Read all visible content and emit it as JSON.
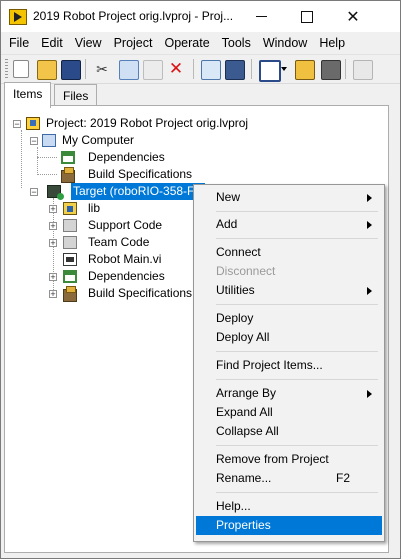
{
  "window": {
    "title": "2019 Robot Project orig.lvproj - Proj...",
    "minimize_icon": "minimize-icon",
    "maximize_icon": "maximize-icon",
    "close_glyph": "✕"
  },
  "menubar": [
    "File",
    "Edit",
    "View",
    "Project",
    "Operate",
    "Tools",
    "Window",
    "Help"
  ],
  "toolbar": {
    "icons": [
      "new-icon",
      "open-icon",
      "save-all-icon",
      "cut-icon",
      "copy-icon",
      "paste-icon",
      "delete-icon",
      "add-files-icon",
      "save-icon",
      "build-icon",
      "dropdown-arrow-icon",
      "wand-icon",
      "resolve-icon",
      "filter-icon"
    ]
  },
  "tabs": [
    {
      "label": "Items",
      "active": true
    },
    {
      "label": "Files",
      "active": false
    }
  ],
  "tree": {
    "project": "Project: 2019 Robot Project orig.lvproj",
    "my_computer": "My Computer",
    "mc_dependencies": "Dependencies",
    "mc_build_specs": "Build Specifications",
    "target": "Target (roboRIO-358-FR",
    "lib": "lib",
    "support_code": "Support Code",
    "team_code": "Team Code",
    "robot_main": "Robot Main.vi",
    "t_dependencies": "Dependencies",
    "t_build_specs": "Build Specifications"
  },
  "context_menu": {
    "new": "New",
    "add": "Add",
    "connect": "Connect",
    "disconnect": "Disconnect",
    "utilities": "Utilities",
    "deploy": "Deploy",
    "deploy_all": "Deploy All",
    "find_items": "Find Project Items...",
    "arrange_by": "Arrange By",
    "expand_all": "Expand All",
    "collapse_all": "Collapse All",
    "remove": "Remove from Project",
    "rename": "Rename...",
    "rename_shortcut": "F2",
    "help": "Help...",
    "properties": "Properties"
  },
  "colors": {
    "selection": "#0078d7",
    "menu_bg": "#f2f2f2",
    "disabled_text": "#9a9a9a"
  }
}
